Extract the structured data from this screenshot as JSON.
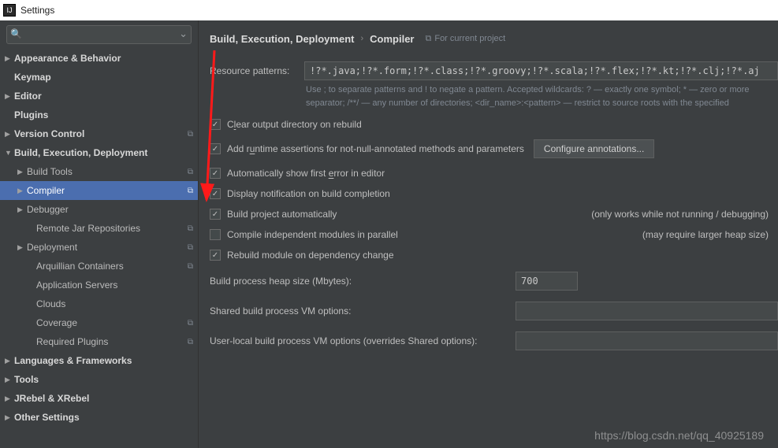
{
  "window": {
    "title": "Settings"
  },
  "sidebar": {
    "search_placeholder": "",
    "items": [
      {
        "label": "Appearance & Behavior",
        "level": 0,
        "arrow": "right",
        "bold": true
      },
      {
        "label": "Keymap",
        "level": 0,
        "bold": true
      },
      {
        "label": "Editor",
        "level": 0,
        "arrow": "right",
        "bold": true
      },
      {
        "label": "Plugins",
        "level": 0,
        "bold": true
      },
      {
        "label": "Version Control",
        "level": 0,
        "arrow": "right",
        "bold": true,
        "scope": true
      },
      {
        "label": "Build, Execution, Deployment",
        "level": 0,
        "arrow": "down",
        "bold": true
      },
      {
        "label": "Build Tools",
        "level": 1,
        "arrow": "right",
        "scope": true
      },
      {
        "label": "Compiler",
        "level": 1,
        "arrow": "right",
        "selected": true,
        "scope": true
      },
      {
        "label": "Debugger",
        "level": 1,
        "arrow": "right"
      },
      {
        "label": "Remote Jar Repositories",
        "level": 2,
        "scope": true
      },
      {
        "label": "Deployment",
        "level": 1,
        "arrow": "right",
        "scope": true
      },
      {
        "label": "Arquillian Containers",
        "level": 2,
        "scope": true
      },
      {
        "label": "Application Servers",
        "level": 2
      },
      {
        "label": "Clouds",
        "level": 2
      },
      {
        "label": "Coverage",
        "level": 2,
        "scope": true
      },
      {
        "label": "Required Plugins",
        "level": 2,
        "scope": true
      },
      {
        "label": "Languages & Frameworks",
        "level": 0,
        "arrow": "right",
        "bold": true
      },
      {
        "label": "Tools",
        "level": 0,
        "arrow": "right",
        "bold": true
      },
      {
        "label": "JRebel & XRebel",
        "level": 0,
        "arrow": "right",
        "bold": true
      },
      {
        "label": "Other Settings",
        "level": 0,
        "arrow": "right",
        "bold": true
      }
    ]
  },
  "breadcrumb": {
    "part1": "Build, Execution, Deployment",
    "part2": "Compiler",
    "scope": "For current project"
  },
  "form": {
    "resource_patterns_label": "Resource patterns:",
    "resource_patterns_value": "!?*.java;!?*.form;!?*.class;!?*.groovy;!?*.scala;!?*.flex;!?*.kt;!?*.clj;!?*.aj",
    "hint": "Use ; to separate patterns and ! to negate a pattern. Accepted wildcards: ? — exactly one symbol; * — zero or more separator; /**/ — any number of directories; <dir_name>:<pattern> — restrict to source roots with the specified",
    "chk_clear": "Clear output directory on rebuild",
    "chk_runtime": "Add runtime assertions for not-null-annotated methods and parameters",
    "btn_configure": "Configure annotations...",
    "chk_autoerr": "Automatically show first error in editor",
    "chk_display": "Display notification on build completion",
    "chk_build": "Build project automatically",
    "note_build": "(only works while not running / debugging)",
    "chk_compile": "Compile independent modules in parallel",
    "note_compile": "(may require larger heap size)",
    "chk_rebuild": "Rebuild module on dependency change",
    "heap_label": "Build process heap size (Mbytes):",
    "heap_value": "700",
    "shared_label": "Shared build process VM options:",
    "shared_value": "",
    "user_label": "User-local build process VM options (overrides Shared options):",
    "user_value": ""
  },
  "watermark": "https://blog.csdn.net/qq_40925189"
}
